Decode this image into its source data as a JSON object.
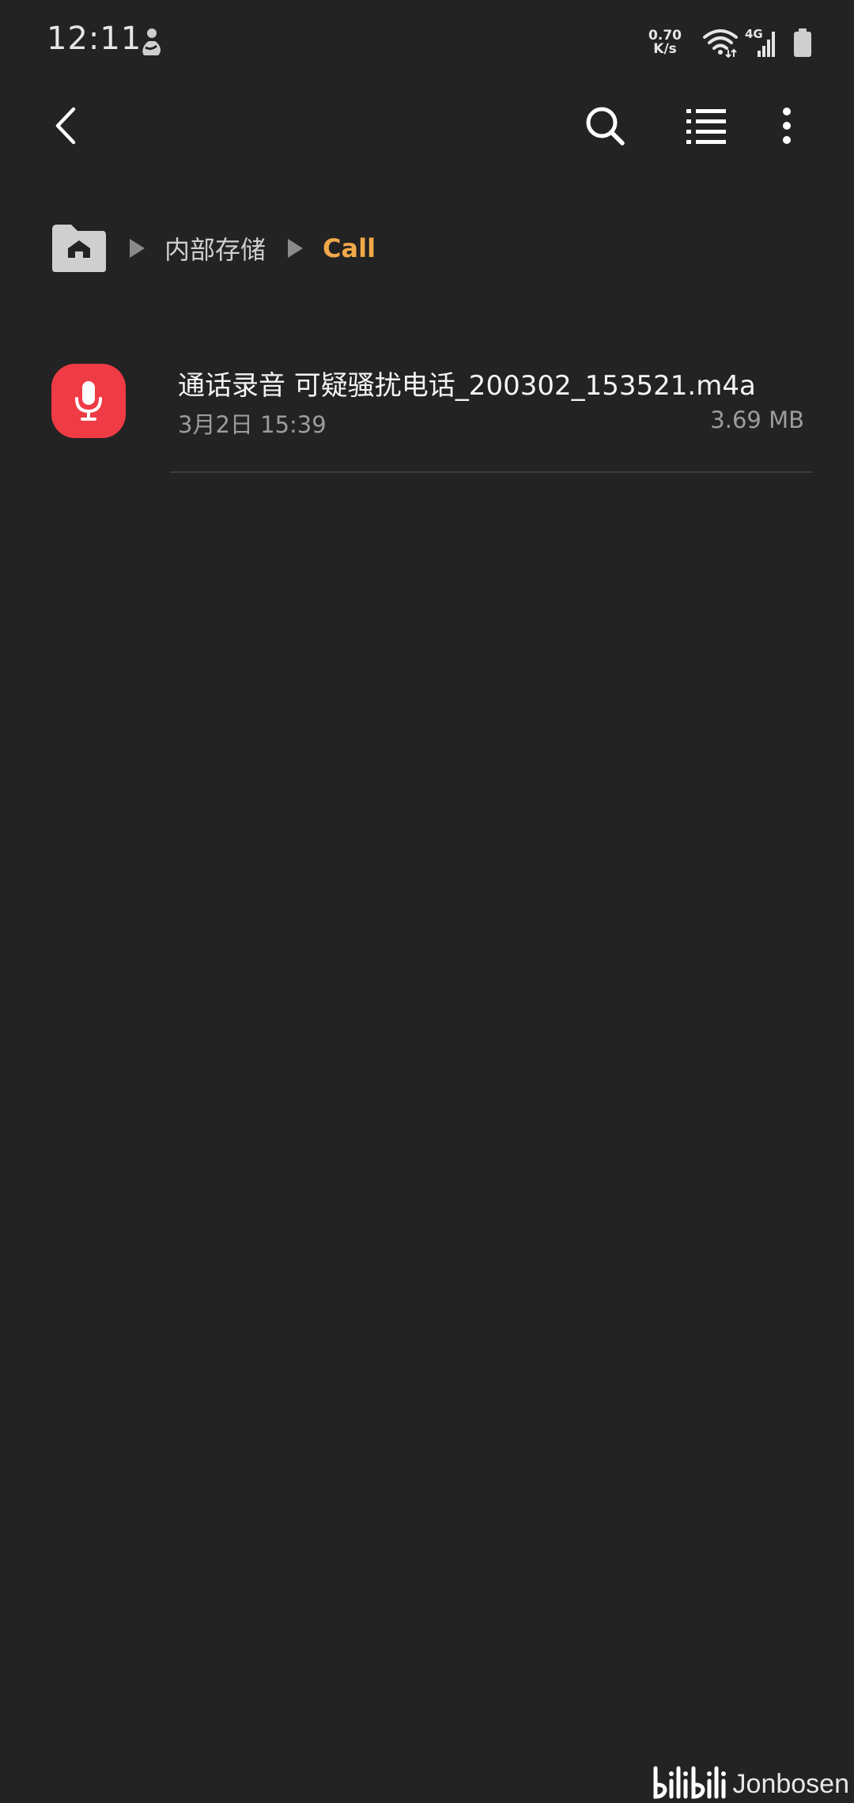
{
  "status_bar": {
    "time": "12:11",
    "net_speed_value": "0.70",
    "net_speed_unit": "K/s",
    "network_type": "4G",
    "icons": [
      "notification-app-icon",
      "wifi-icon",
      "signal-icon",
      "battery-icon"
    ]
  },
  "app_bar": {
    "icons": [
      "back-arrow-icon",
      "search-icon",
      "list-view-icon",
      "more-vert-icon"
    ]
  },
  "breadcrumb": {
    "home_icon": "home-folder-icon",
    "items": [
      {
        "label": "内部存储"
      },
      {
        "label": "Call"
      }
    ],
    "current_color": "#f2a94a"
  },
  "files": [
    {
      "name": "通话录音 可疑骚扰电话_200302_153521.m4a",
      "date": "3月2日 15:39",
      "size": "3.69 MB",
      "icon": "microphone-icon",
      "icon_color": "#ef3b45"
    }
  ],
  "watermark": {
    "logo_text": "bilibili",
    "user": "Jonbosen"
  },
  "colors": {
    "background": "#222322",
    "accent": "#f2a94a",
    "divider": "#3c3d3c"
  }
}
